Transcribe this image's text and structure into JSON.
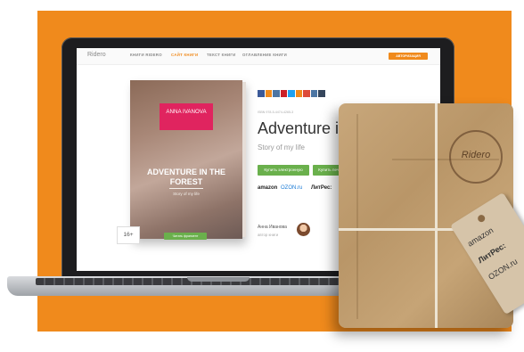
{
  "nav": {
    "brand": "Ridero",
    "items": [
      "КНИГИ RIDERO",
      "САЙТ КНИГИ",
      "ТЕКСТ КНИГИ",
      "ОГЛАВЛЕНИЕ КНИГИ"
    ],
    "active_index": 1,
    "auth_label": "АВТОРИЗАЦИЯ"
  },
  "book": {
    "author": "ANNA IVANOVA",
    "title": "ADVENTURE IN THE FOREST",
    "subtitle": "Story of my life",
    "age": "16+",
    "read_label": "Читать фрагмент"
  },
  "social_icons": [
    "facebook-icon",
    "odnoklassniki-icon",
    "vk-icon",
    "pinterest-icon",
    "twitter-icon",
    "odnoklassniki-icon",
    "google-plus-icon",
    "vk-icon",
    "tumblr-icon"
  ],
  "social_colors": [
    "#3b5998",
    "#f08a1c",
    "#4c75a3",
    "#cb2027",
    "#1da1f2",
    "#f08a1c",
    "#dd4b39",
    "#4c75a3",
    "#35465c"
  ],
  "page": {
    "meta": "ISBN 978-5-4474-4265-3",
    "title": "Adventure in t",
    "subtitle": "Story of my life",
    "buy_ebook": "Купить электронную",
    "buy_print": "Купить печа"
  },
  "stores": {
    "amazon": "amazon",
    "ozon": "OZON.ru",
    "litres": "ЛитРес:"
  },
  "author": {
    "name": "Анна Иванова",
    "role": "автор книги"
  },
  "package": {
    "stamp": "Riderо",
    "tag_lines": [
      "amazon",
      "ЛитРес:",
      "OZON.ru"
    ]
  },
  "colors": {
    "accent": "#f08a1c",
    "green": "#6ab04c",
    "pink": "#e0245f"
  }
}
